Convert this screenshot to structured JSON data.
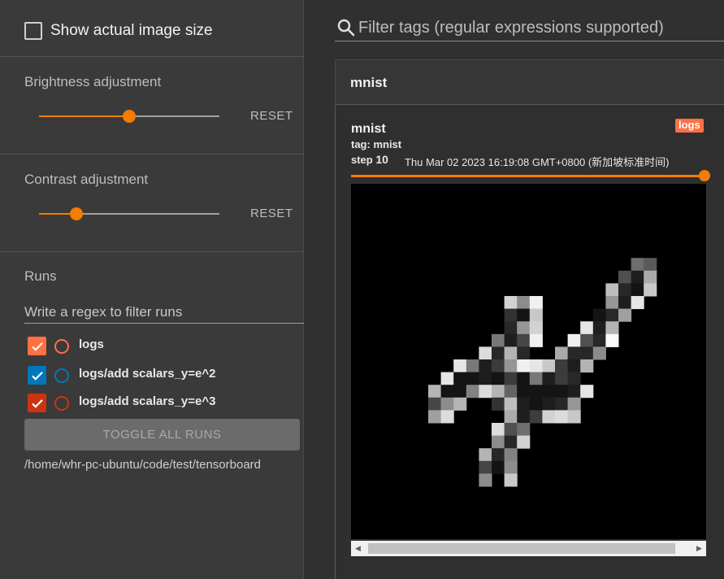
{
  "sidebar": {
    "show_actual_size": {
      "label": "Show actual image size",
      "checked": false
    },
    "brightness": {
      "title": "Brightness adjustment",
      "reset_label": "RESET",
      "value_fraction": 0.5
    },
    "contrast": {
      "title": "Contrast adjustment",
      "reset_label": "RESET",
      "value_fraction": 0.2
    },
    "runs": {
      "title": "Runs",
      "filter_placeholder": "Write a regex to filter runs",
      "items": [
        {
          "label": "logs",
          "checked": true,
          "color": "#ff7043"
        },
        {
          "label": "logs/add scalars_y=e^2",
          "checked": true,
          "color": "#0077bb"
        },
        {
          "label": "logs/add scalars_y=e^3",
          "checked": true,
          "color": "#cc3311"
        }
      ],
      "toggle_all_label": "TOGGLE ALL RUNS",
      "logdir": "/home/whr-pc-ubuntu/code/test/tensorboard"
    }
  },
  "main": {
    "filter": {
      "placeholder": "Filter tags (regular expressions supported)"
    },
    "group": {
      "title": "mnist"
    },
    "card": {
      "title": "mnist",
      "run_badge": "logs",
      "tag_line": "tag: mnist",
      "step_label": "step",
      "step_value": "10",
      "timestamp": "Thu Mar 02 2023 16:19:08 GMT+0800 (新加坡标准时间)",
      "step_fraction": 1.0
    }
  },
  "colors": {
    "accent": "#f57c00",
    "background": "#303030",
    "sidebar": "#3a3a3a"
  },
  "icons": {
    "search": "search-icon",
    "checkmark": "check-icon",
    "scroll_left": "arrow-left-icon",
    "scroll_right": "arrow-right-icon"
  }
}
